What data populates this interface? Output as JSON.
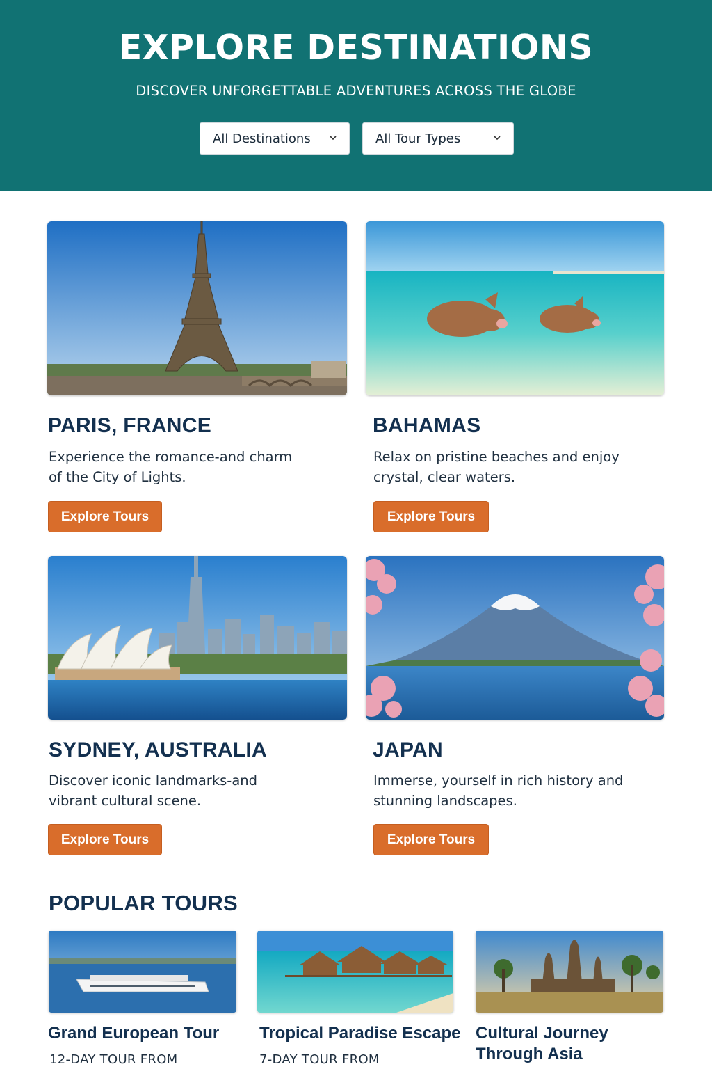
{
  "hero": {
    "title": "EXPLORE DESTINATIONS",
    "subtitle": "DISCOVER UNFORGETTABLE ADVENTURES ACROSS THE GLOBE",
    "filters": {
      "destination": {
        "selected": "All Destinations",
        "icon": "chevron-down-icon"
      },
      "tour_type": {
        "selected": "All Tour Types",
        "icon": "chevron-down-icon"
      }
    }
  },
  "destinations": [
    {
      "title": "PARIS, FRANCE",
      "description": "Experience the romance-and charm of the City of Lights.",
      "button": "Explore Tours"
    },
    {
      "title": "BAHAMAS",
      "description": "Relax on pristine beaches and enjoy crystal, clear waters.",
      "button": "Explore Tours"
    },
    {
      "title": "SYDNEY, AUSTRALIA",
      "description": "Discover iconic landmarks-and vibrant cultural scene.",
      "button": "Explore Tours"
    },
    {
      "title": "JAPAN",
      "description": "Immerse, yourself in rich history and stunning landscapes.",
      "button": "Explore Tours"
    }
  ],
  "popular_tours": {
    "heading": "POPULAR TOURS",
    "items": [
      {
        "title": "Grand European Tour",
        "subtitle": "12-DAY TOUR FROM"
      },
      {
        "title": "Tropical Paradise Escape",
        "subtitle": "7-DAY TOUR FROM"
      },
      {
        "title": "Cultural Journey Through Asia",
        "subtitle": ""
      }
    ]
  },
  "colors": {
    "hero_bg": "#117273",
    "accent_button": "#d96d2b",
    "heading_text": "#13304f"
  }
}
